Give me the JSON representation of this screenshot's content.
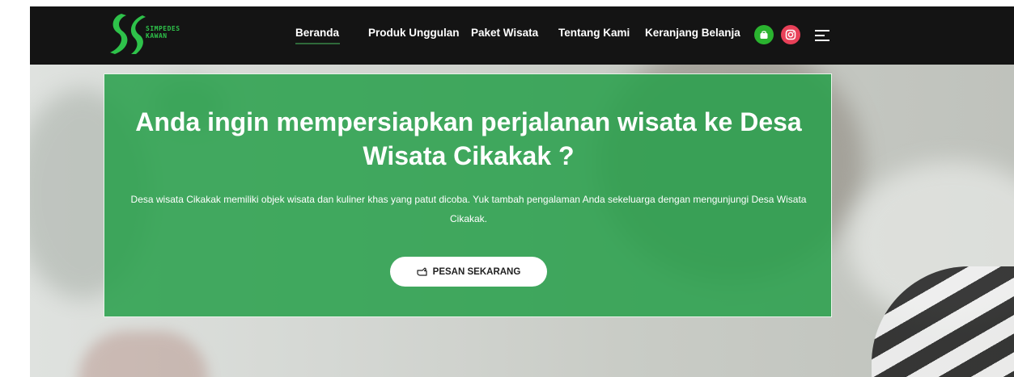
{
  "brand": {
    "line1": "SIMPEDES",
    "line2": "KAWAN",
    "color": "#2ec24a"
  },
  "nav": {
    "items": [
      {
        "label": "Beranda",
        "active": true
      },
      {
        "label": "Produk Unggulan"
      },
      {
        "label": "Paket Wisata"
      },
      {
        "label": "Tentang Kami"
      },
      {
        "label": "Keranjang Belanja"
      }
    ],
    "icons": [
      "shopping-bag-icon",
      "instagram-icon",
      "menu-icon"
    ]
  },
  "hero": {
    "headline": "Anda ingin mempersiapkan perjalanan wisata ke Desa Wisata Cikakak ?",
    "description": "Desa wisata Cikakak memiliki objek wisata dan kuliner khas yang patut dicoba. Yuk tambah pengalaman Anda sekeluarga dengan mengunjungi Desa Wisata Cikakak.",
    "cta_label": "PESAN SEKARANG",
    "cta_icon": "pointing-hand-icon"
  },
  "colors": {
    "navbar": "#141414",
    "overlay_green": "#28a04b",
    "shop_icon": "#2ab32f",
    "instagram_icon": "#e84058"
  }
}
